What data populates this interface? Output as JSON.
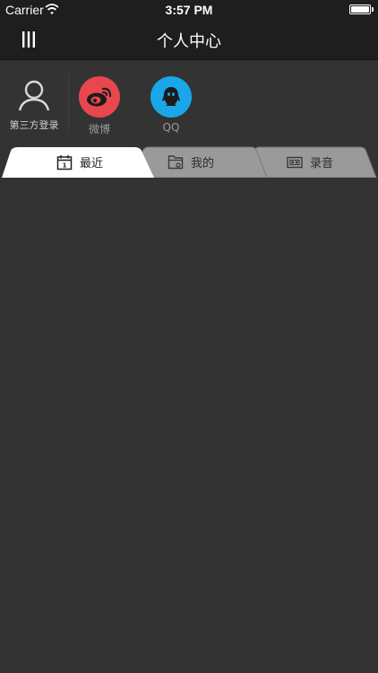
{
  "status_bar": {
    "carrier": "Carrier",
    "time": "3:57 PM",
    "battery_level": 1.0
  },
  "nav": {
    "title": "个人中心",
    "menu_icon": "hamburger-icon"
  },
  "login": {
    "third_party_label": "第三方登录",
    "providers": [
      {
        "name": "微博",
        "icon": "weibo-icon",
        "color": "#e8474d"
      },
      {
        "name": "QQ",
        "icon": "qq-icon",
        "color": "#1aa6e8"
      }
    ]
  },
  "tabs": [
    {
      "label": "最近",
      "icon": "calendar-icon",
      "selected": true
    },
    {
      "label": "我的",
      "icon": "folder-icon",
      "selected": false
    },
    {
      "label": "录音",
      "icon": "cassette-icon",
      "selected": false
    }
  ],
  "colors": {
    "background": "#333333",
    "bar": "#1e1e1e",
    "tab_active": "#ffffff",
    "tab_inactive": "#9a9a9a"
  }
}
